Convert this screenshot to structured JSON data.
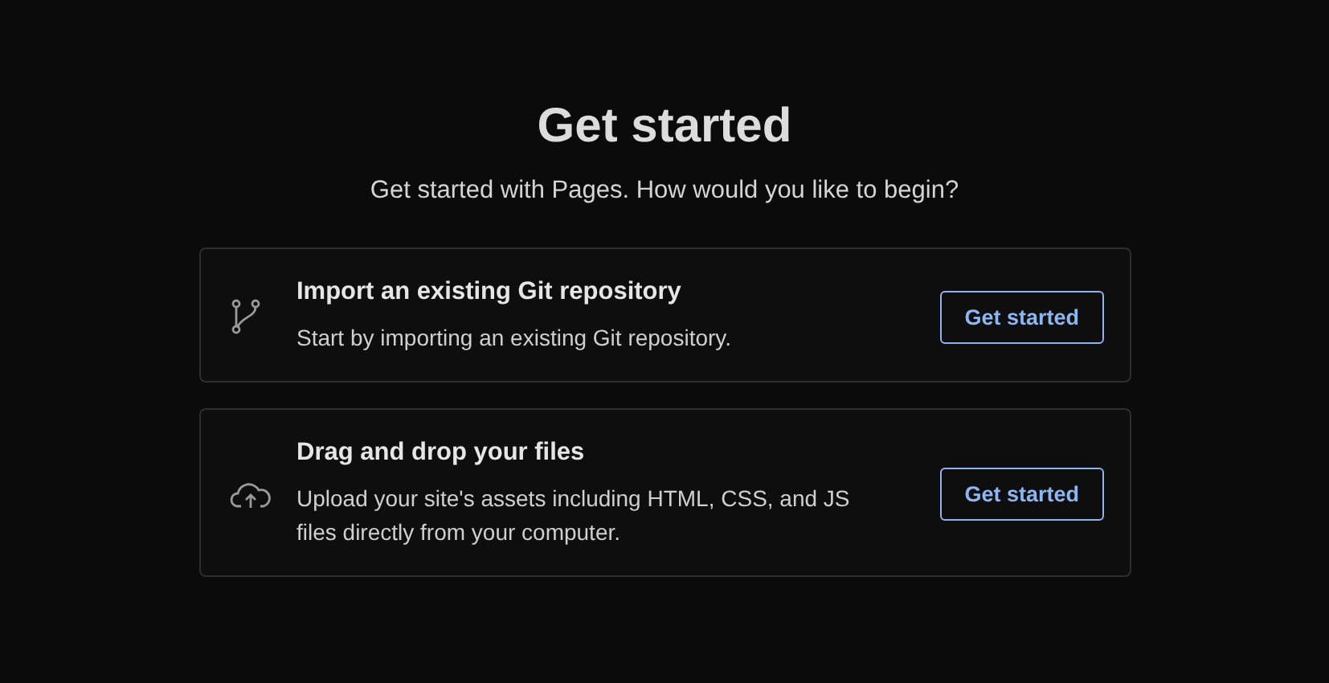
{
  "heading": "Get started",
  "subtitle": "Get started with Pages. How would you like to begin?",
  "options": [
    {
      "kind": "git",
      "title": "Import an existing Git repository",
      "description": "Start by importing an existing Git repository.",
      "button": "Get started"
    },
    {
      "kind": "upload",
      "title": "Drag and drop your files",
      "description": "Upload your site's assets including HTML, CSS, and JS files directly from your computer.",
      "button": "Get started"
    }
  ]
}
